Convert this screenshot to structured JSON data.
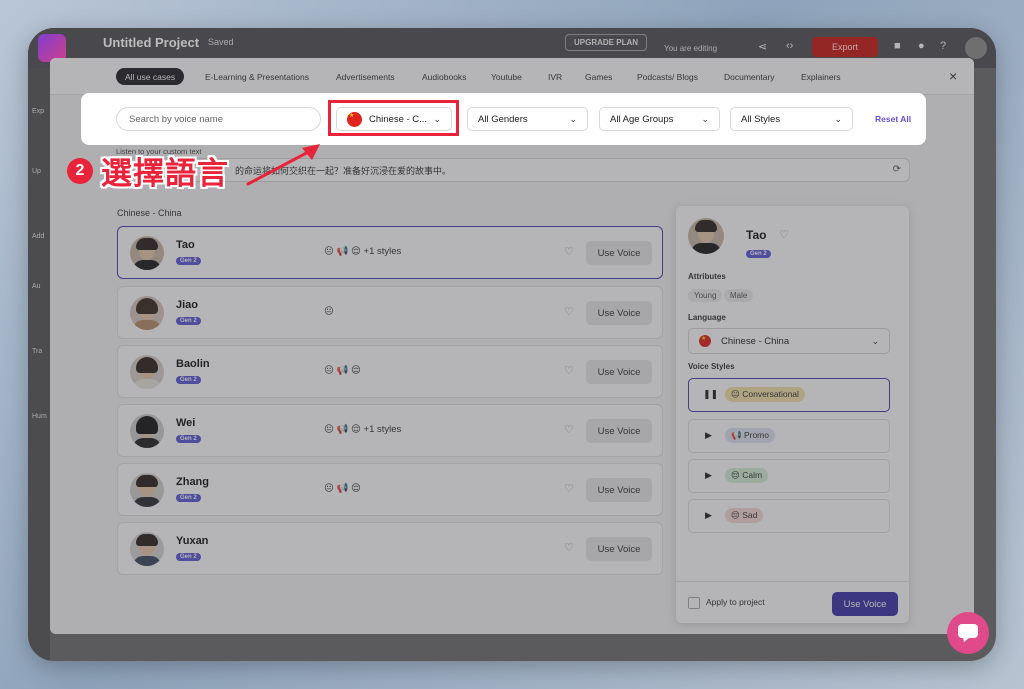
{
  "app": {
    "title": "Untitled Project",
    "saved": "Saved",
    "upgrade": "UPGRADE PLAN",
    "editing": "You are editing",
    "export": "Export"
  },
  "modal": {
    "tabs": [
      "All use cases",
      "E-Learning & Presentations",
      "Advertisements",
      "Audiobooks",
      "Youtube",
      "IVR",
      "Games",
      "Podcasts/ Blogs",
      "Documentary",
      "Explainers"
    ],
    "close": "×"
  },
  "filters": {
    "search_placeholder": "Search by voice name",
    "language": "Chinese - C...",
    "genders": "All Genders",
    "age": "All Age Groups",
    "styles": "All Styles",
    "reset": "Reset All"
  },
  "annotation": {
    "step": "2",
    "text": "選擇語言",
    "color": "#e8233a"
  },
  "custom_text": {
    "label": "Listen to your custom text",
    "value": "的命运将如何交织在一起？准备好沉浸在爱的故事中。"
  },
  "section_label": "Chinese - China",
  "voices": [
    {
      "name": "Tao",
      "gen": "Gen 2",
      "styles": "😐 📢 😌 +1 styles",
      "use": "Use Voice"
    },
    {
      "name": "Jiao",
      "gen": "Gen 2",
      "styles": "😐",
      "use": "Use Voice"
    },
    {
      "name": "Baolin",
      "gen": "Gen 2",
      "styles": "😐 📢 😌",
      "use": "Use Voice"
    },
    {
      "name": "Wei",
      "gen": "Gen 2",
      "styles": "😐 📢 😌 +1 styles",
      "use": "Use Voice"
    },
    {
      "name": "Zhang",
      "gen": "Gen 2",
      "styles": "😐 📢 😌",
      "use": "Use Voice"
    },
    {
      "name": "Yuxan",
      "gen": "Gen 2",
      "styles": "",
      "use": "Use Voice"
    }
  ],
  "panel": {
    "name": "Tao",
    "gen": "Gen 2",
    "attributes_label": "Attributes",
    "attributes": [
      "Young",
      "Male"
    ],
    "language_label": "Language",
    "language": "Chinese - China",
    "voice_styles_label": "Voice Styles",
    "styles": [
      {
        "label": "😐 Conversational",
        "color": "#f7e3a8",
        "playing": true
      },
      {
        "label": "📢 Promo",
        "color": "#dfe4f2",
        "playing": false
      },
      {
        "label": "😌 Calm",
        "color": "#d5f0d8",
        "playing": false
      },
      {
        "label": "😔 Sad",
        "color": "#f7d9d6",
        "playing": false
      }
    ],
    "apply": "Apply to project",
    "use": "Use Voice"
  },
  "side_labels": [
    "Exp",
    "Up",
    "Add",
    "Au",
    "Tra",
    "Hum"
  ]
}
